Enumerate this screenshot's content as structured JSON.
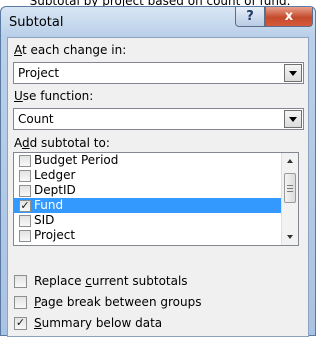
{
  "caption": "Subtotal by project based on count of fund.",
  "dialog": {
    "title": "Subtotal",
    "help_label": "?",
    "close_label": "x"
  },
  "at_each_change": {
    "label_prefix": "",
    "label_accel": "A",
    "label_rest": "t each change in:",
    "value": "Project"
  },
  "use_function": {
    "label_accel": "U",
    "label_rest": "se function:",
    "value": "Count"
  },
  "add_subtotal": {
    "label_start": "A",
    "label_accel": "d",
    "label_rest": "d subtotal to:",
    "items": [
      {
        "label": "Budget Period",
        "checked": false,
        "selected": false
      },
      {
        "label": "Ledger",
        "checked": false,
        "selected": false
      },
      {
        "label": "DeptID",
        "checked": false,
        "selected": false
      },
      {
        "label": "Fund",
        "checked": true,
        "selected": true
      },
      {
        "label": "SID",
        "checked": false,
        "selected": false
      },
      {
        "label": "Project",
        "checked": false,
        "selected": false
      }
    ]
  },
  "options": {
    "replace": {
      "label_start": "Replace ",
      "label_accel": "c",
      "label_rest": "urrent subtotals",
      "checked": false
    },
    "page_break": {
      "label_start": "",
      "label_accel": "P",
      "label_rest": "age break between groups",
      "checked": false
    },
    "summary": {
      "label_start": "",
      "label_accel": "S",
      "label_rest": "ummary below data",
      "checked": true
    }
  },
  "check_glyph": "✓"
}
